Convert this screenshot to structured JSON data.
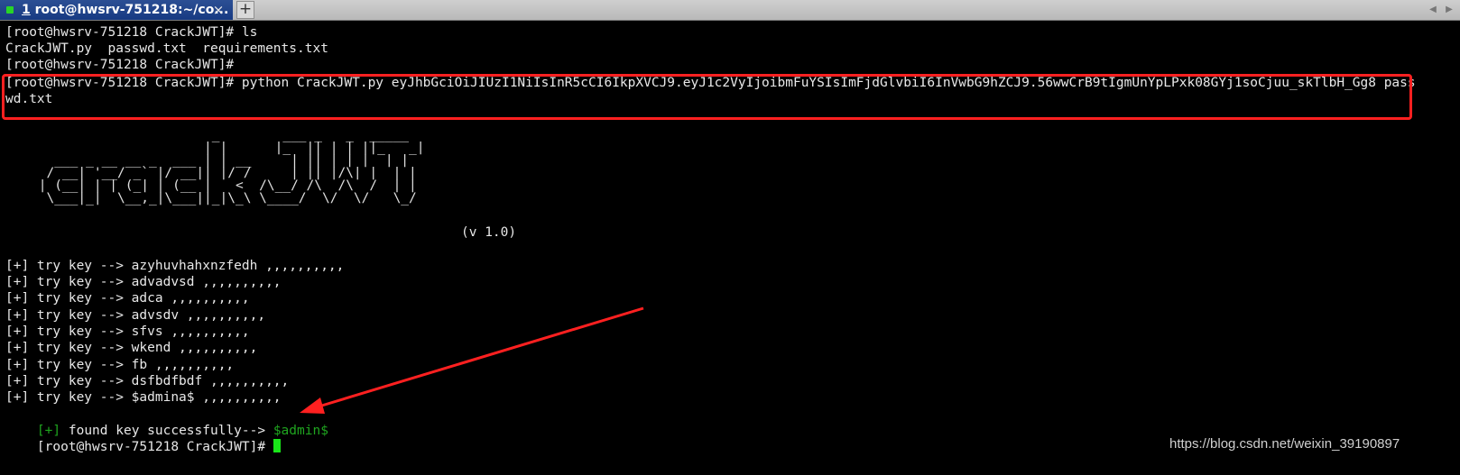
{
  "tab": {
    "number": "1",
    "title": "root@hwsrv-751218:~/co...",
    "close_glyph": "×",
    "status_color": "#28d428"
  },
  "toolbar": {
    "new_tab_glyph": "+",
    "scroll_left_glyph": "◀",
    "scroll_right_glyph": "▶"
  },
  "terminal": {
    "lines": [
      "[root@hwsrv-751218 CrackJWT]# ls",
      "CrackJWT.py  passwd.txt  requirements.txt",
      "[root@hwsrv-751218 CrackJWT]# ",
      "[root@hwsrv-751218 CrackJWT]# python CrackJWT.py eyJhbGciOiJIUzI1NiIsInR5cCI6IkpXVCJ9.eyJ1c2VyIjoibmFuYSIsImFjdGlvbiI6InVwbG9hZCJ9.56wwCrB9tIgmUnYpLPxk08GYj1soCjuu_skTlbH_Gg8 pass",
      "wd.txt"
    ],
    "banner": "                       _        ___ _   _  _____\n                      | |      |_  || | | ||_   _|\n   ___ _ __ __ _  ___ | | __     | || | | |  | |\n  / __| '__/ _` |/ __|| |/ /     | || |/\\| |  | |\n | (__| | | (_| | (__ |   <  /\\__/ /\\  /\\  /  | |\n  \\___|_|  \\__,_|\\___||_|\\_\\ \\____/  \\/  \\/   \\_/",
    "version": "(v 1.0)",
    "attempts": [
      "[+] try key --> azyhuvhahxnzfedh ,,,,,,,,,,",
      "[+] try key --> advadvsd ,,,,,,,,,,",
      "[+] try key --> adca ,,,,,,,,,,",
      "[+] try key --> advsdv ,,,,,,,,,,",
      "[+] try key --> sfvs ,,,,,,,,,,",
      "[+] try key --> wkend ,,,,,,,,,,",
      "[+] try key --> fb ,,,,,,,,,,",
      "[+] try key --> dsfbdfbdf ,,,,,,,,,,",
      "[+] try key --> $admina$ ,,,,,,,,,,"
    ],
    "found": {
      "marker": "[+]",
      "text": " found key successfully--> ",
      "key": "$admin$"
    },
    "prompt": "[root@hwsrv-751218 CrackJWT]# ",
    "cursor_color": "#19e619"
  },
  "annotation": {
    "box_color": "#ff2020",
    "arrow_color": "#ff2020"
  },
  "watermark": "https://blog.csdn.net/weixin_39190897"
}
